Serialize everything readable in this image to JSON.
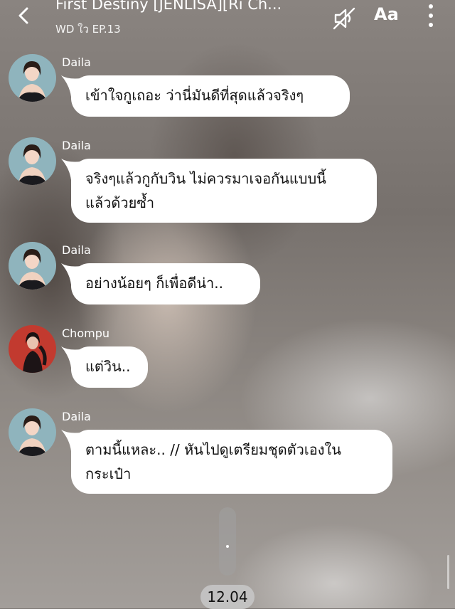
{
  "header": {
    "title": "First Destiny [JENLISA][Ri Ch...",
    "subtitle": "WD ใว EP.13",
    "font_label": "Aa",
    "back_icon": "chevron-left-icon",
    "mute_icon": "speaker-muted-icon",
    "more_icon": "more-vertical-icon"
  },
  "messages": [
    {
      "sender": "Daila",
      "lines": [
        "เข้าใจกูเถอะ ว่านี่มันดีที่สุดแล้วจริงๆ"
      ]
    },
    {
      "sender": "Daila",
      "lines": [
        "จริงๆแล้วกูกับวิน ไม่ควรมาเจอกันแบบนี้",
        "แล้วด้วยซ้ำ"
      ]
    },
    {
      "sender": "Daila",
      "lines": [
        "อย่างน้อยๆ ก็เพื่อดีน่า.."
      ]
    },
    {
      "sender": "Chompu",
      "lines": [
        "แต่วิน.."
      ]
    },
    {
      "sender": "Daila",
      "lines": [
        "ตามนี้แหละ.. // หันไปดูเตรียมชุดตัวเองใน",
        "กระเป๋า"
      ]
    }
  ],
  "footer": {
    "time": "12.04"
  },
  "colors": {
    "bubble": "#ffffff",
    "daila_avatar_bg": "#8fb4bd",
    "chompu_avatar_bg": "#c23a2f"
  }
}
